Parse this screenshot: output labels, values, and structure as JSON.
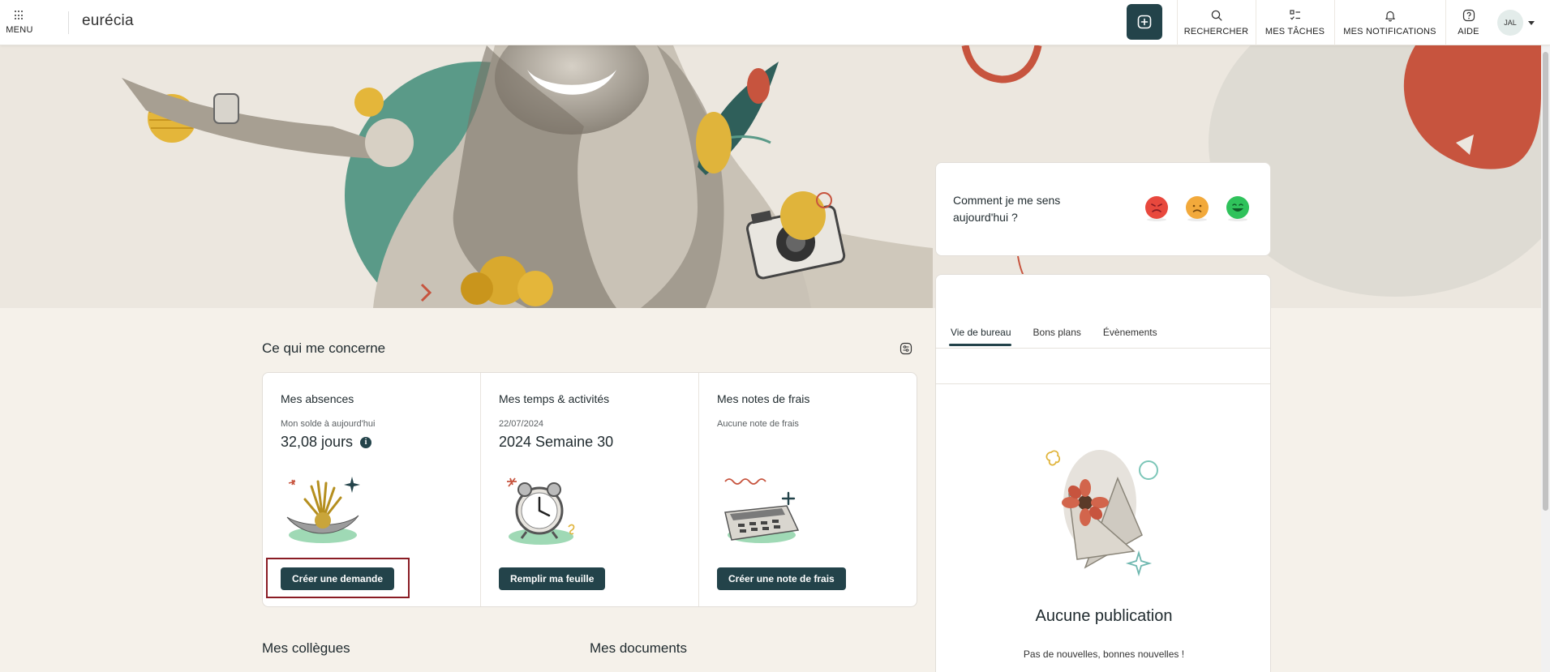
{
  "header": {
    "menu_label": "MENU",
    "logo": "eurécia",
    "nav": [
      {
        "label": "RECHERCHER",
        "icon": "search-icon"
      },
      {
        "label": "MES TÂCHES",
        "icon": "tasks-icon"
      },
      {
        "label": "MES NOTIFICATIONS",
        "icon": "bell-icon"
      },
      {
        "label": "AIDE",
        "icon": "help-icon"
      }
    ],
    "avatar_initials": "JAL"
  },
  "main": {
    "section_title": "Ce qui me concerne",
    "cards": [
      {
        "title": "Mes absences",
        "sub": "Mon solde à aujourd'hui",
        "value": "32,08 jours",
        "button": "Créer une demande"
      },
      {
        "title": "Mes temps & activités",
        "sub": "22/07/2024",
        "value": "2024 Semaine 30",
        "button": "Remplir ma feuille"
      },
      {
        "title": "Mes notes de frais",
        "sub": "Aucune note de frais",
        "value": "",
        "button": "Créer une note de frais"
      }
    ],
    "colleagues_title": "Mes collègues",
    "documents_title": "Mes documents"
  },
  "mood": {
    "question": "Comment je me sens aujourd'hui ?",
    "options": [
      "angry-face-icon",
      "sad-face-icon",
      "happy-face-icon"
    ],
    "colors": [
      "#e8483d",
      "#f2a93b",
      "#2fc25b"
    ]
  },
  "news": {
    "tabs": [
      "Vie de bureau",
      "Bons plans",
      "Évènements"
    ],
    "active_tab": "Vie de bureau",
    "empty_title": "Aucune publication",
    "empty_sub": "Pas de nouvelles, bonnes nouvelles !"
  },
  "colors": {
    "primary": "#23434a",
    "background": "#f5f1ea",
    "highlight": "#8a1c24"
  }
}
